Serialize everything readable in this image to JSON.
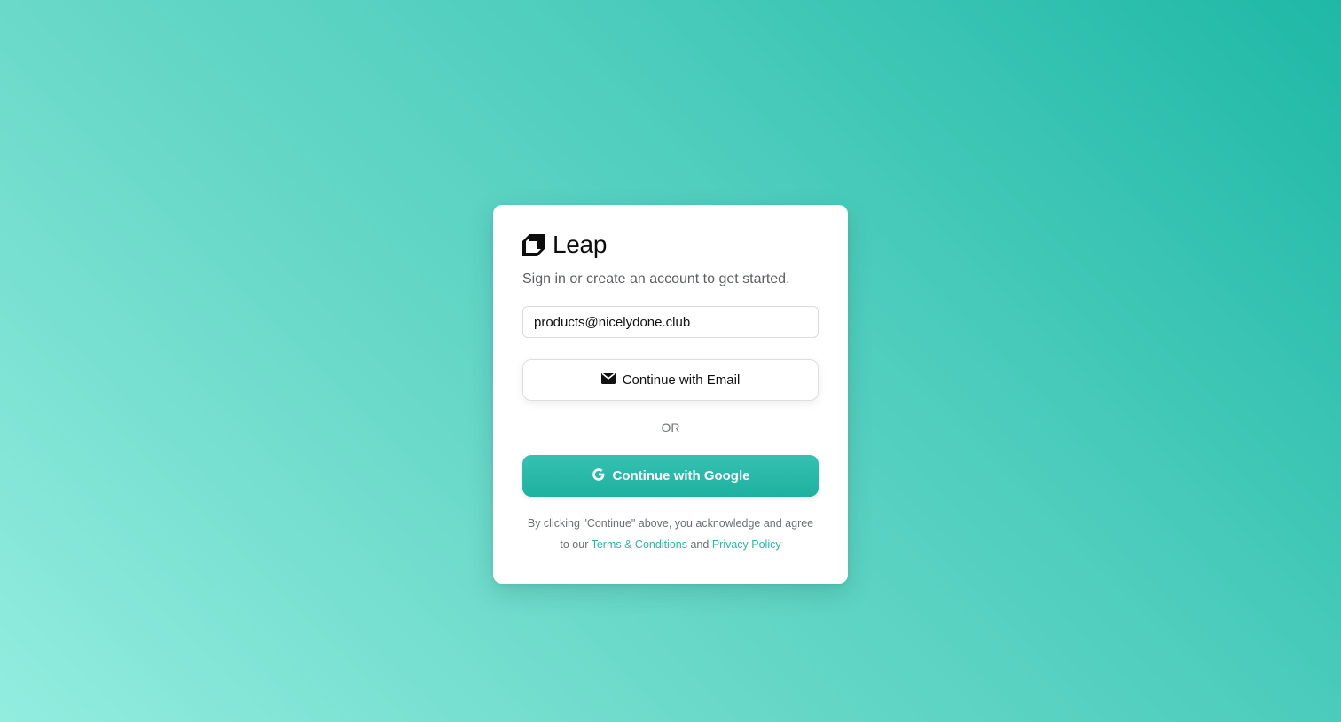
{
  "brand": {
    "name": "Leap",
    "logo_icon": "leap-logo-icon"
  },
  "subtitle": "Sign in or create an account to get started.",
  "email_input": {
    "value": "products@nicelydone.club",
    "placeholder": ""
  },
  "email_button": {
    "label": "Continue with Email",
    "icon": "envelope-icon"
  },
  "divider": {
    "label": "OR"
  },
  "google_button": {
    "label": "Continue with Google",
    "icon": "google-icon"
  },
  "legal": {
    "line1": "By clicking \"Continue\" above, you acknowledge and agree",
    "prefix": "to our",
    "terms_label": "Terms & Conditions",
    "and": "and",
    "privacy_label": "Privacy Policy"
  },
  "colors": {
    "accent": "#2bb6a5",
    "background_start": "#1fb8a6",
    "background_end": "#92eddf"
  }
}
